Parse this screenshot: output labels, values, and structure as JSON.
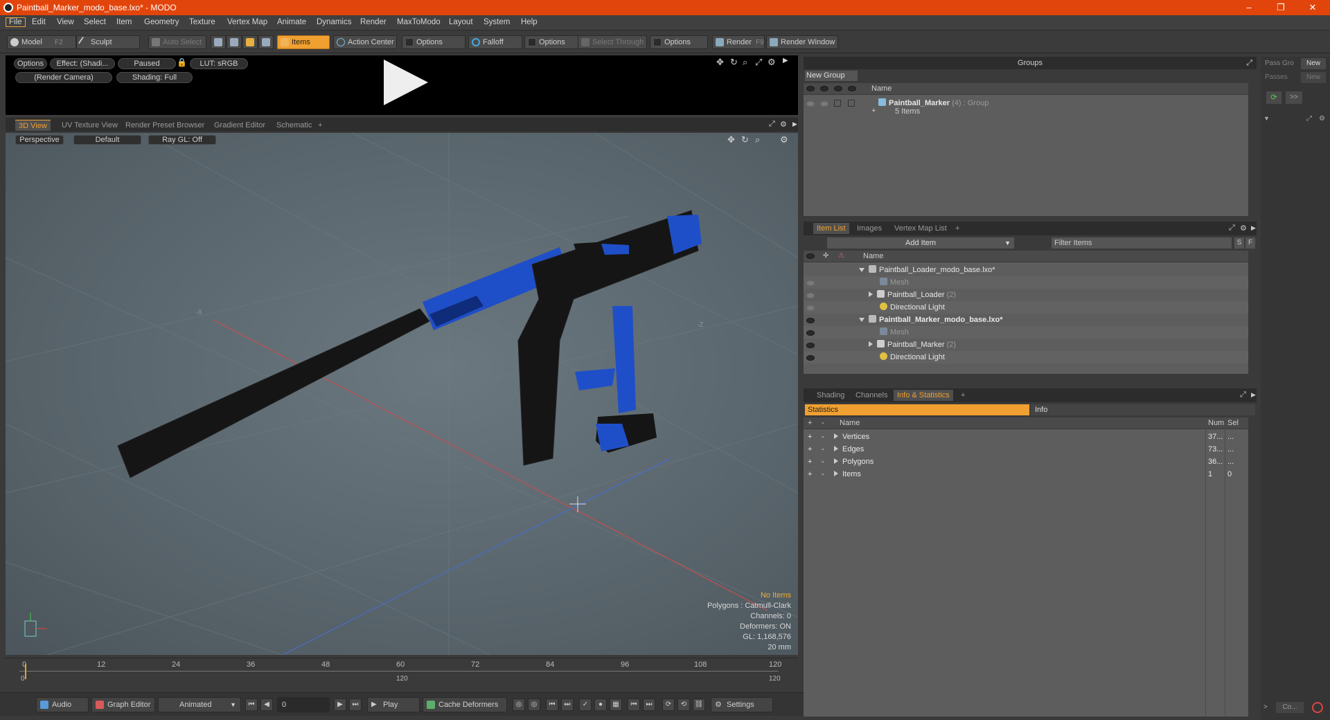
{
  "window": {
    "title": "Paintball_Marker_modo_base.lxo* - MODO",
    "minimize": "–",
    "maximize": "❐",
    "close": "✕"
  },
  "menu": [
    "File",
    "Edit",
    "View",
    "Select",
    "Item",
    "Geometry",
    "Texture",
    "Vertex Map",
    "Animate",
    "Dynamics",
    "Render",
    "MaxToModo",
    "Layout",
    "System",
    "Help"
  ],
  "toolbar": {
    "model": "Model",
    "model_key": "F2",
    "sculpt": "Sculpt",
    "auto_select": "Auto Select",
    "items": "Items",
    "action_center": "Action Center",
    "options1": "Options",
    "falloff": "Falloff",
    "options2": "Options",
    "select_through": "Select Through",
    "options3": "Options",
    "render": "Render",
    "render_key": "F9",
    "render_window": "Render Window"
  },
  "player": {
    "options": "Options",
    "effect": "Effect: (Shadi...",
    "paused": "Paused",
    "lut": "LUT: sRGB",
    "camera": "(Render Camera)",
    "shading": "Shading: Full"
  },
  "viewport_tabs": [
    "3D View",
    "UV Texture View",
    "Render Preset Browser",
    "Gradient Editor",
    "Schematic",
    "+"
  ],
  "viewport": {
    "perspective": "Perspective",
    "default": "Default",
    "raygl": "Ray GL: Off",
    "axis_x": "-X",
    "axis_z": "-Z",
    "info": {
      "no_items": "No Items",
      "polygons": "Polygons : Catmull-Clark",
      "channels": "Channels: 0",
      "deformers": "Deformers: ON",
      "gl": "GL: 1,168,576",
      "scale": "20 mm"
    }
  },
  "timeline": {
    "ticks": [
      "0",
      "12",
      "24",
      "36",
      "48",
      "60",
      "72",
      "84",
      "96",
      "108",
      "120"
    ],
    "sub_ticks": [
      "0",
      "120",
      "120"
    ]
  },
  "bottombar": {
    "audio": "Audio",
    "graph_editor": "Graph Editor",
    "animated": "Animated",
    "frame": "0",
    "play": "Play",
    "cache_deformers": "Cache Deformers",
    "settings": "Settings"
  },
  "groups": {
    "header": "Groups",
    "new_group": "New Group",
    "col_name": "Name",
    "row_name": "Paintball_Marker",
    "row_count": "(4)",
    "row_type": ": Group",
    "row_sub": "5 Items"
  },
  "pass": {
    "pass_gro": "Pass Gro",
    "passes": "Passes",
    "new1": "New",
    "new2": "New",
    "more": ">>",
    "co": "Co..."
  },
  "item_list": {
    "tabs": [
      "Item List",
      "Images",
      "Vertex Map List",
      "+"
    ],
    "add_item": "Add Item",
    "filter_items": "Filter Items",
    "s": "S",
    "f": "F",
    "col_name": "Name",
    "rows": [
      {
        "label": "Paintball_Loader_modo_base.lxo*",
        "count": ""
      },
      {
        "label": "Mesh",
        "count": ""
      },
      {
        "label": "Paintball_Loader",
        "count": "(2)"
      },
      {
        "label": "Directional Light",
        "count": ""
      },
      {
        "label": "Paintball_Marker_modo_base.lxo*",
        "count": ""
      },
      {
        "label": "Mesh",
        "count": ""
      },
      {
        "label": "Paintball_Marker",
        "count": "(2)"
      },
      {
        "label": "Directional Light",
        "count": ""
      }
    ]
  },
  "stats": {
    "tabs": [
      "Shading",
      "Channels",
      "Info & Statistics",
      "+"
    ],
    "statistics": "Statistics",
    "info": "Info",
    "col_name": "Name",
    "col_num": "Num",
    "col_sel": "Sel",
    "plus": "+",
    "minus": "-",
    "rows": [
      {
        "name": "Vertices",
        "num": "37...",
        "sel": "..."
      },
      {
        "name": "Edges",
        "num": "73...",
        "sel": "..."
      },
      {
        "name": "Polygons",
        "num": "36...",
        "sel": "..."
      },
      {
        "name": "Items",
        "num": "1",
        "sel": "0"
      }
    ]
  },
  "colors": {
    "title_bar": "#e2450c",
    "accent": "#f0a030",
    "blue_grip": "#1f4fc8"
  }
}
